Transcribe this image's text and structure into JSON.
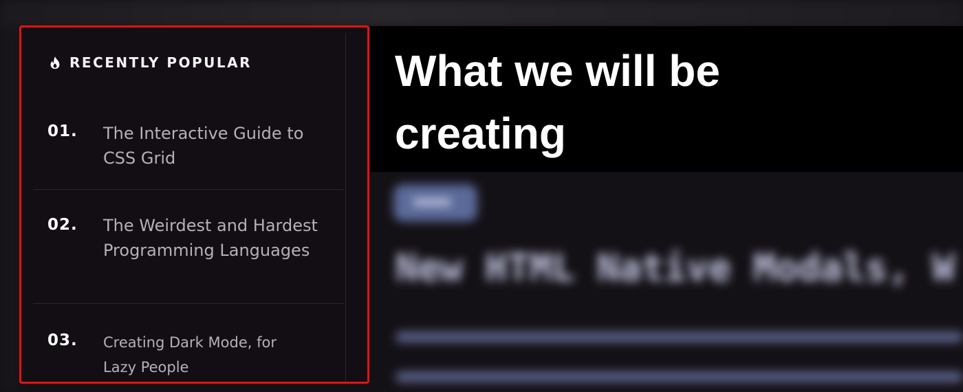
{
  "title_banner": {
    "text": "What we will be creating"
  },
  "background": {
    "heading_text": "New HTML Native Modals, W"
  },
  "popular_panel": {
    "heading": "RECENTLY POPULAR",
    "icon": "flame-icon",
    "border_color": "#e01414",
    "items": [
      {
        "number": "01.",
        "title": "The Interactive Guide to CSS Grid"
      },
      {
        "number": "02.",
        "title": "The Weirdest and Hardest Programming Languages"
      },
      {
        "number": "03.",
        "title": "Creating Dark Mode, for Lazy People"
      }
    ]
  }
}
